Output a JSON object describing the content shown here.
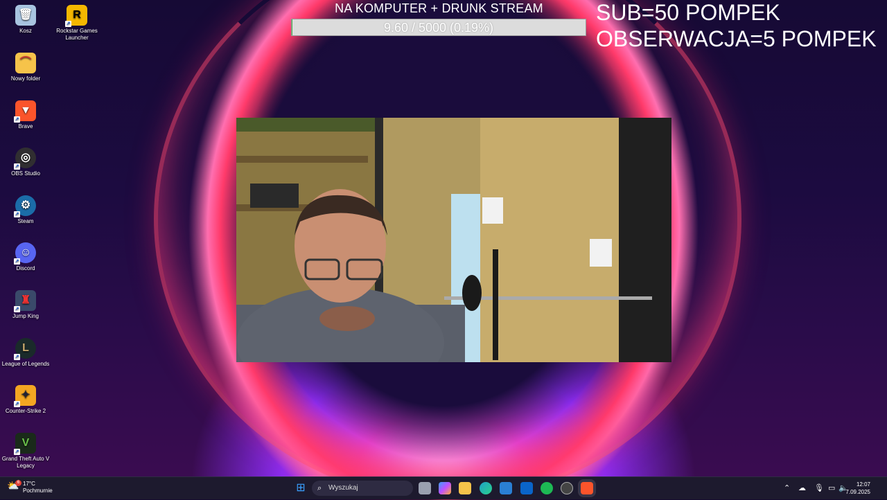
{
  "desktop": {
    "icons": [
      {
        "label": "Kosz",
        "icon": "recycle-bin-icon",
        "color": "#a8c4e0"
      },
      {
        "label": "Rockstar Games Launcher",
        "icon": "rockstar-icon",
        "color": "#f5b700"
      },
      {
        "label": "Nowy folder",
        "icon": "folder-icon",
        "color": "#f6c34a"
      },
      {
        "label": "Brave",
        "icon": "brave-icon",
        "color": "#fb542b"
      },
      {
        "label": "OBS Studio",
        "icon": "obs-icon",
        "color": "#302e31"
      },
      {
        "label": "Steam",
        "icon": "steam-icon",
        "color": "#1b6ca8"
      },
      {
        "label": "Discord",
        "icon": "discord-icon",
        "color": "#5865f2"
      },
      {
        "label": "Jump King",
        "icon": "jump-king-icon",
        "color": "#3a4a6a"
      },
      {
        "label": "League of Legends",
        "icon": "league-icon",
        "color": "#c8aa6e"
      },
      {
        "label": "Counter-Strike 2",
        "icon": "cs2-icon",
        "color": "#f4a622"
      },
      {
        "label": "Grand Theft Auto V Legacy",
        "icon": "gta-icon",
        "color": "#4a8a3a"
      }
    ]
  },
  "overlay": {
    "title": "NA KOMPUTER + DRUNK STREAM",
    "progress_text": "9.60 / 5000 (0.19%)",
    "progress_fraction": 0.0019,
    "goal1": "SUB=50 POMPEK",
    "goal2": "OBSERWACJA=5 POMPEK"
  },
  "taskbar": {
    "weather_temp": "17°C",
    "weather_desc": "Pochmurnie",
    "weather_badge": "6",
    "search_placeholder": "Wyszukaj",
    "apps": [
      {
        "icon": "windows-start-icon",
        "color": "#3aa0ff"
      },
      {
        "icon": "task-view-icon",
        "color": "#9aa0b0"
      },
      {
        "icon": "copilot-icon",
        "color": "#7a6cff"
      },
      {
        "icon": "file-explorer-icon",
        "color": "#f6c34a"
      },
      {
        "icon": "edge-icon",
        "color": "#1fa0c8"
      },
      {
        "icon": "store-icon",
        "color": "#2a7fd4"
      },
      {
        "icon": "outlook-icon",
        "color": "#0a64c8"
      },
      {
        "icon": "spotify-icon",
        "color": "#1db954"
      },
      {
        "icon": "obs-taskbar-icon",
        "color": "#444"
      },
      {
        "icon": "brave-taskbar-icon",
        "color": "#fb542b"
      }
    ],
    "time": "12:07",
    "date": "7.09.2025"
  }
}
